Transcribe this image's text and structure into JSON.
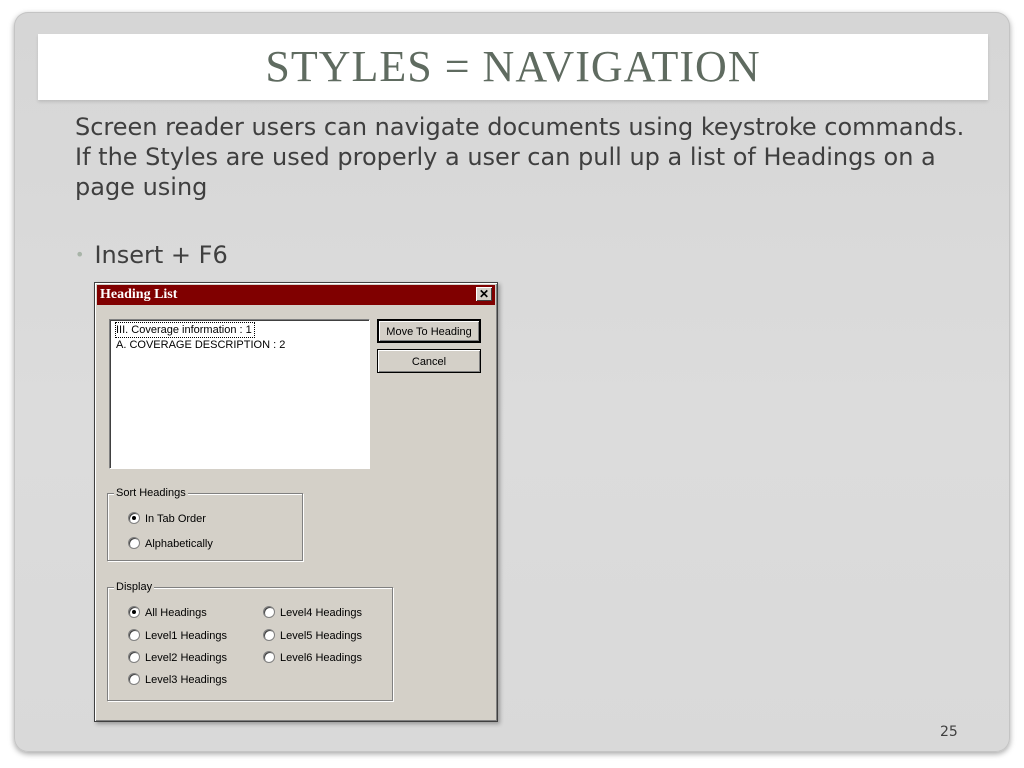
{
  "slide": {
    "title": "STYLES = NAVIGATION",
    "paragraphs": [
      "Screen reader users can navigate documents using keystroke commands.",
      "If the Styles are used properly a user can pull up a list of Headings on a page using"
    ],
    "bullet": "Insert + F6",
    "page_number": "25"
  },
  "dialog": {
    "title": "Heading List",
    "close_glyph": "✕",
    "list_items": [
      "III.  Coverage information : 1",
      "A. COVERAGE DESCRIPTION : 2"
    ],
    "buttons": {
      "move_to_heading": "Move To Heading",
      "cancel": "Cancel"
    },
    "sort_group": {
      "label": "Sort Headings",
      "options": [
        "In Tab Order",
        "Alphabetically"
      ],
      "selected": "In Tab Order"
    },
    "display_group": {
      "label": "Display",
      "options": [
        "All Headings",
        "Level1 Headings",
        "Level2 Headings",
        "Level3 Headings",
        "Level4 Headings",
        "Level5 Headings",
        "Level6 Headings"
      ],
      "selected": "All Headings"
    }
  },
  "colors": {
    "title_text": "#5f6b60",
    "dialog_titlebar": "#800000",
    "dialog_face": "#d4d0c8"
  }
}
